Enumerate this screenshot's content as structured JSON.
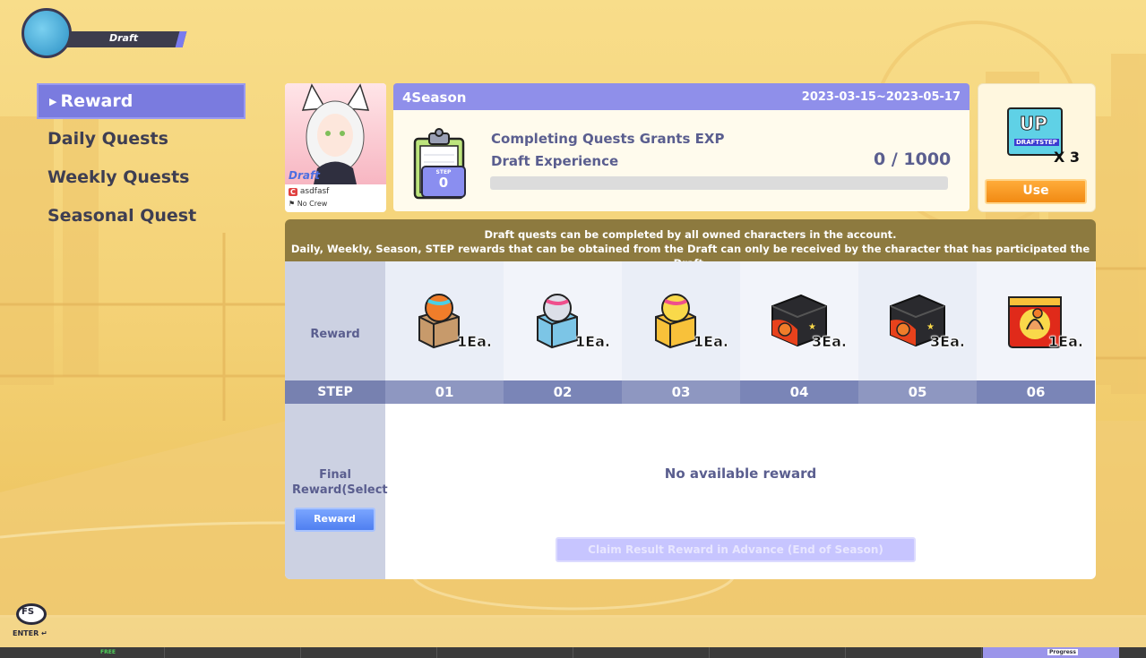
{
  "header": {
    "mode_label": "Draft"
  },
  "menu": {
    "items": [
      {
        "label": "Reward",
        "active": true
      },
      {
        "label": "Daily Quests",
        "active": false
      },
      {
        "label": "Weekly Quests",
        "active": false
      },
      {
        "label": "Seasonal Quest",
        "active": false
      }
    ]
  },
  "card": {
    "label": "Draft",
    "crew_mark": "C",
    "name": "asdfasf",
    "crew": "No Crew"
  },
  "season": {
    "title": "4Season",
    "date_range": "2023-03-15~2023-05-17",
    "quest_line1": "Completing Quests Grants EXP",
    "quest_line2": "Draft Experience",
    "step_label": "STEP",
    "step_value": "0",
    "exp_text": "0 / 1000",
    "exp_progress": 0
  },
  "step_up": {
    "icon_text": "UP",
    "sub_text": "DRAFTSTEP",
    "count": "X 3",
    "use_label": "Use"
  },
  "notice": {
    "line1": "Draft quests can be completed by all owned characters in the account.",
    "line2": "Daily, Weekly, Season, STEP rewards that can be obtained from the Draft can only be received by the character that has participated the Draft."
  },
  "rewards": {
    "row_label": "Reward",
    "step_label": "STEP",
    "items": [
      {
        "step": "01",
        "qty": "1Ea.",
        "icon": "orange-ball-box-icon"
      },
      {
        "step": "02",
        "qty": "1Ea.",
        "icon": "blue-ball-box-icon"
      },
      {
        "step": "03",
        "qty": "1Ea.",
        "icon": "gold-ball-box-icon"
      },
      {
        "step": "04",
        "qty": "3Ea.",
        "icon": "black-fire-box-icon"
      },
      {
        "step": "05",
        "qty": "3Ea.",
        "icon": "black-fire-box-icon"
      },
      {
        "step": "06",
        "qty": "1Ea.",
        "icon": "red-gift-box-icon"
      }
    ],
    "final_label": "Final Reward(Select",
    "final_button": "Reward",
    "no_reward": "No available reward",
    "claim_button": "Claim Result Reward in Advance (End of Season)"
  },
  "footer": {
    "logo_text": "FS",
    "enter_text": "ENTER",
    "free_text": "FREE",
    "progress_text": "Progress"
  },
  "colors": {
    "accent": "#8f8fea",
    "use_button": "#f18a13",
    "notice_bg": "#8d7a3f",
    "reward_button": "#4f7ff0"
  }
}
